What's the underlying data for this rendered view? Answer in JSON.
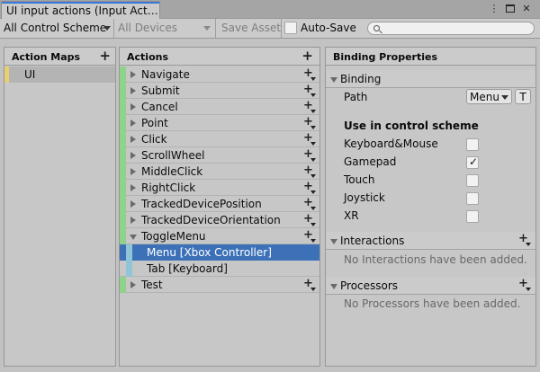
{
  "window": {
    "tab_title": "UI input actions (Input Act…",
    "menu_icon": "kebab-menu-icon",
    "maximize_icon": "maximize-icon",
    "close_icon": "close-icon",
    "menu_glyph": "⋮",
    "close_glyph": "✕"
  },
  "toolbar": {
    "control_scheme": "All Control Scheme",
    "devices": "All Devices",
    "save_asset": "Save Asset",
    "auto_save_label": "Auto-Save",
    "auto_save_checked": false,
    "search_placeholder": "",
    "search_value": ""
  },
  "action_maps": {
    "header": "Action Maps",
    "add_glyph": "+",
    "items": [
      {
        "label": "UI",
        "selected": true,
        "color": "#e8cf73"
      }
    ]
  },
  "actions": {
    "header": "Actions",
    "add_glyph": "+",
    "add_binding_glyph": "+",
    "action_color": "#8ed38a",
    "binding_color": "#8fc5d6",
    "items": [
      {
        "label": "Navigate",
        "expanded": false
      },
      {
        "label": "Submit",
        "expanded": false
      },
      {
        "label": "Cancel",
        "expanded": false
      },
      {
        "label": "Point",
        "expanded": false
      },
      {
        "label": "Click",
        "expanded": false
      },
      {
        "label": "ScrollWheel",
        "expanded": false
      },
      {
        "label": "MiddleClick",
        "expanded": false
      },
      {
        "label": "RightClick",
        "expanded": false
      },
      {
        "label": "TrackedDevicePosition",
        "expanded": false
      },
      {
        "label": "TrackedDeviceOrientation",
        "expanded": false
      },
      {
        "label": "ToggleMenu",
        "expanded": true,
        "bindings": [
          {
            "label": "Menu [Xbox Controller]",
            "selected": true
          },
          {
            "label": "Tab [Keyboard]",
            "selected": false
          }
        ]
      },
      {
        "label": "Test",
        "expanded": false
      }
    ],
    "selection_color": "#3c71b8"
  },
  "properties": {
    "header": "Binding Properties",
    "binding_section": "Binding",
    "path_label": "Path",
    "path_value": "Menu",
    "t_button": "T",
    "use_in_scheme_label": "Use in control scheme",
    "schemes": [
      {
        "label": "Keyboard&Mouse",
        "checked": false
      },
      {
        "label": "Gamepad",
        "checked": true
      },
      {
        "label": "Touch",
        "checked": false
      },
      {
        "label": "Joystick",
        "checked": false
      },
      {
        "label": "XR",
        "checked": false
      }
    ],
    "checkmark_glyph": "✓",
    "interactions_section": "Interactions",
    "interactions_empty": "No Interactions have been added.",
    "processors_section": "Processors",
    "processors_empty": "No Processors have been added.",
    "add_glyph": "+"
  }
}
